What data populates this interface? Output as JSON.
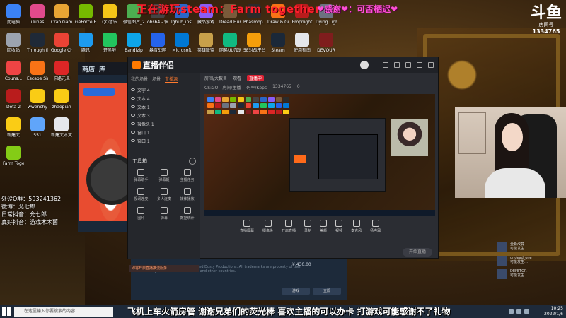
{
  "banner": {
    "left": "正在游玩steam：Farm together",
    "right": "❤感谢❤：可否栖迟❤"
  },
  "logo": {
    "mark": "斗鱼",
    "sub": "房间号",
    "room": "1334765"
  },
  "desktop_icons": [
    {
      "label": "此电脑",
      "color": "#3b82f6"
    },
    {
      "label": "iTunes",
      "color": "#e24a8b"
    },
    {
      "label": "Crab Game",
      "color": "#e8a534"
    },
    {
      "label": "GeForce Experience",
      "color": "#76b900"
    },
    {
      "label": "QQ音乐",
      "color": "#f5c518"
    },
    {
      "label": "微信图片_2021111...",
      "color": "#4caf50"
    },
    {
      "label": "obs64 - 快捷方式",
      "color": "#444444"
    },
    {
      "label": "lghub_inst...",
      "color": "#2a66c9"
    },
    {
      "label": "藏品游戏",
      "color": "#8b5cf6"
    },
    {
      "label": "Dread Hunger",
      "color": "#7a5a3a"
    },
    {
      "label": "Phasmop...",
      "color": "#2b2b2b"
    },
    {
      "label": "Draw & Guess",
      "color": "#f97316"
    },
    {
      "label": "Propnight",
      "color": "#b91c1c"
    },
    {
      "label": "Dying Light 2",
      "color": "#6b7280"
    },
    {
      "label": "回收站",
      "color": "#9ca3af"
    },
    {
      "label": "Through the Wire Sour...",
      "color": "#1f2937"
    },
    {
      "label": "Google Chrome",
      "color": "#ea4335"
    },
    {
      "label": "腾讯",
      "color": "#1d9bf0"
    },
    {
      "label": "开黑啦",
      "color": "#22c55e"
    },
    {
      "label": "Bandizip",
      "color": "#0ea5e9"
    },
    {
      "label": "暴雪战网",
      "color": "#2563eb"
    },
    {
      "label": "Microsoft",
      "color": "#0078d4"
    },
    {
      "label": "英雄联盟",
      "color": "#c8a04a"
    },
    {
      "label": "网易UU加速",
      "color": "#10b981"
    },
    {
      "label": "5E对战平台",
      "color": "#f59e0b"
    },
    {
      "label": "Steam",
      "color": "#1b2838"
    },
    {
      "label": "使用指南",
      "color": "#e5e7eb"
    },
    {
      "label": "DEVOUR",
      "color": "#7f1d1d"
    },
    {
      "label": "Couns...",
      "color": "#ef4444"
    },
    {
      "label": "Escape Simulator",
      "color": "#f97316"
    },
    {
      "label": "卡路元旦",
      "color": "#dc2626"
    },
    {
      "label": "Dota 2",
      "color": "#b91c1c"
    },
    {
      "label": "wwenchy",
      "color": "#facc15"
    },
    {
      "label": "zhaopian",
      "color": "#facc15"
    },
    {
      "label": "新建文",
      "color": "#facc15"
    },
    {
      "label": "551",
      "color": "#60a5fa"
    },
    {
      "label": "新建文本文档 (3)",
      "color": "#e5e7eb"
    },
    {
      "label": "Farm Together",
      "color": "#84cc16"
    }
  ],
  "info_lines": [
    "外设Q群：593241362",
    "微博：允七郎",
    "日常抖音：允七郎",
    "真好抖音：游戏木木菌"
  ],
  "steam": {
    "tab_store": "商店",
    "tab_library": "库"
  },
  "app": {
    "name": "直播伴侣",
    "left_tabs": [
      "我的场景",
      "场景",
      "直播源"
    ],
    "sources": [
      "文字 4",
      "文本 4",
      "文本 1",
      "文本 3",
      "摄像头 1",
      "窗口 1",
      "窗口 1"
    ],
    "tool_header": "工具箱",
    "tools": [
      "弹幕助手",
      "弹幕姬",
      "主播任务",
      "视讯连麦",
      "多人连麦",
      "媒体播放",
      "图片",
      "弹幕",
      "数据统计"
    ],
    "notice": "即将开启直播推流服务…",
    "info_bar": [
      "房间/大数目",
      "观看",
      "直播中",
      "CS:GO - 房间/主播",
      "码率/Kbps",
      "1334765",
      "0"
    ],
    "bottom_tools": [
      "直播屏幕",
      "摄像头",
      "开启直播",
      "录制",
      "美颜",
      "视频",
      "麦克风",
      "扬声器"
    ],
    "start_btn": "开始直播",
    "nested_start": "开始直播"
  },
  "dark_panel": {
    "meta": "© 2022 Valve Corporation and Dusty Productions. All trademarks are property of their respective owners in the US and other countries.",
    "price": "¥ 430.00",
    "btn1": "游戏",
    "btn2": "立即"
  },
  "chat": [
    {
      "name": "全新改变",
      "msg": "可能发生…"
    },
    {
      "name": "undead_one",
      "msg": "可能发生…"
    },
    {
      "name": "DEFETOR",
      "msg": "可能发生…"
    }
  ],
  "subtitle": "飞机上车火箭房管 谢谢兄弟们的荧光棒 喜欢主播的可以办卡 打游戏可能感谢不了礼物",
  "taskbar": {
    "search_placeholder": "在这里输入你要搜索的内容",
    "time": "10:25",
    "date": "2022/1/6"
  }
}
